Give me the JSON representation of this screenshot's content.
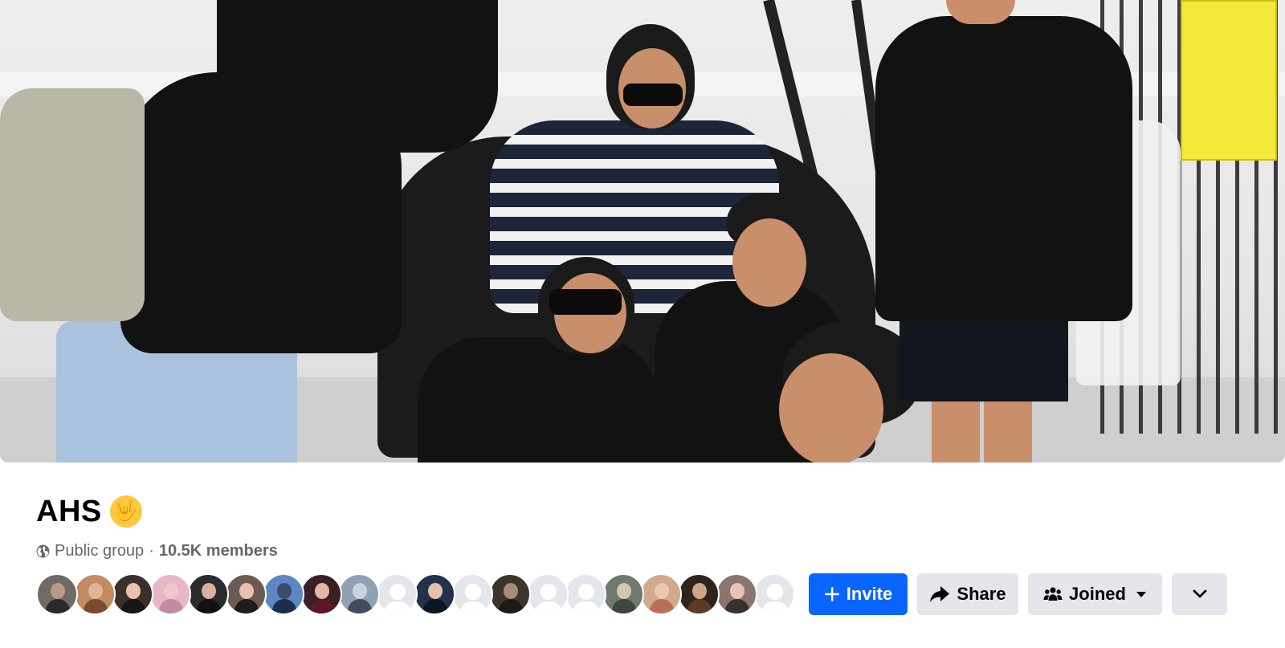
{
  "group": {
    "name": "AHS",
    "emoji": "🤟",
    "privacy": "Public group",
    "separator": "·",
    "members": "10.5K members"
  },
  "cover_photo": {
    "description_icon": "cover-photo"
  },
  "member_avatars": [
    {
      "kind": "photo",
      "skin": "#b99a86",
      "bg": "#6f6a66",
      "cloth": "#2a2a2a"
    },
    {
      "kind": "photo",
      "skin": "#e3b596",
      "bg": "#c28b63",
      "cloth": "#7a4b2d"
    },
    {
      "kind": "photo",
      "skin": "#e9c3b0",
      "bg": "#3b2f2b",
      "cloth": "#161616"
    },
    {
      "kind": "photo",
      "skin": "#f0c8c8",
      "bg": "#e7b6c9",
      "cloth": "#c48aa3"
    },
    {
      "kind": "photo",
      "skin": "#d9b29c",
      "bg": "#2b2b2b",
      "cloth": "#111111"
    },
    {
      "kind": "photo",
      "skin": "#e7c1ad",
      "bg": "#6d5a55",
      "cloth": "#1c1c1c"
    },
    {
      "kind": "photo",
      "skin": "#3a4d6a",
      "bg": "#5d86c2",
      "cloth": "#1d2e4d"
    },
    {
      "kind": "photo",
      "skin": "#e2b8a3",
      "bg": "#3b1f25",
      "cloth": "#5a1824"
    },
    {
      "kind": "photo",
      "skin": "#c7d3de",
      "bg": "#8fa2b5",
      "cloth": "#3f4d5c"
    },
    {
      "kind": "default"
    },
    {
      "kind": "photo",
      "skin": "#e5c1ad",
      "bg": "#21324a",
      "cloth": "#0d1624"
    },
    {
      "kind": "default"
    },
    {
      "kind": "photo",
      "skin": "#a88c76",
      "bg": "#3c332c",
      "cloth": "#1e1a17"
    },
    {
      "kind": "default"
    },
    {
      "kind": "default"
    },
    {
      "kind": "photo",
      "skin": "#d7c6a7",
      "bg": "#6e7a6f",
      "cloth": "#3d463f"
    },
    {
      "kind": "photo",
      "skin": "#ecc7b2",
      "bg": "#d3a98e",
      "cloth": "#b86f55"
    },
    {
      "kind": "photo",
      "skin": "#cfa58a",
      "bg": "#2f241d",
      "cloth": "#5b3b28"
    },
    {
      "kind": "photo",
      "skin": "#e8c4b2",
      "bg": "#8a7570",
      "cloth": "#39302d"
    },
    {
      "kind": "default"
    }
  ],
  "actions": {
    "invite_label": "Invite",
    "share_label": "Share",
    "joined_label": "Joined",
    "more_icon": "chevron-down-icon"
  },
  "colors": {
    "primary": "#0866ff",
    "secondary_bg": "#e4e6eb",
    "meta_text": "#65676b"
  }
}
